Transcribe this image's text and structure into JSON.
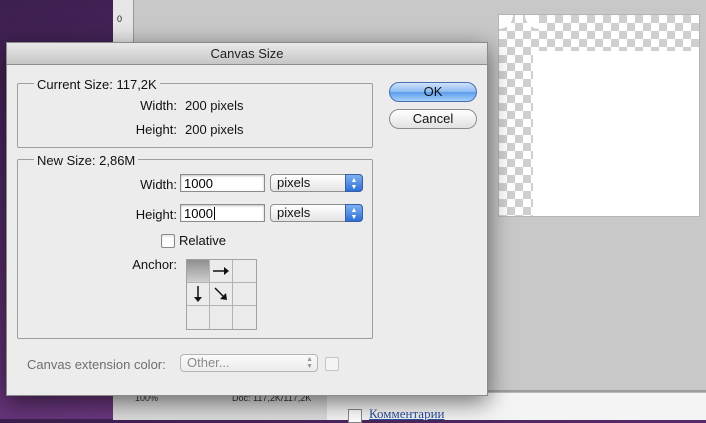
{
  "background": {
    "ruler_number": "0",
    "zoom": "100%",
    "doc_info": "Doc: 117,2K/117,2K",
    "comments_link": "Комментарии",
    "status_scroll_arrow": "▶"
  },
  "dialog": {
    "title": "Canvas Size",
    "current_size": {
      "title": "Current Size: 117,2K",
      "width_label": "Width:",
      "width_value": "200 pixels",
      "height_label": "Height:",
      "height_value": "200 pixels"
    },
    "new_size": {
      "title": "New Size: 2,86M",
      "width_label": "Width:",
      "width_value": "1000",
      "width_unit": "pixels",
      "height_label": "Height:",
      "height_value": "1000",
      "height_unit": "pixels",
      "relative_label": "Relative",
      "relative_checked": false,
      "anchor_label": "Anchor:"
    },
    "extension_color": {
      "label": "Canvas extension color:",
      "value": "Other..."
    },
    "ok_label": "OK",
    "cancel_label": "Cancel"
  },
  "colors": {
    "default_button": "#5b9cec",
    "dialog_bg": "#ececec",
    "desktop": "#5a2d6e"
  }
}
